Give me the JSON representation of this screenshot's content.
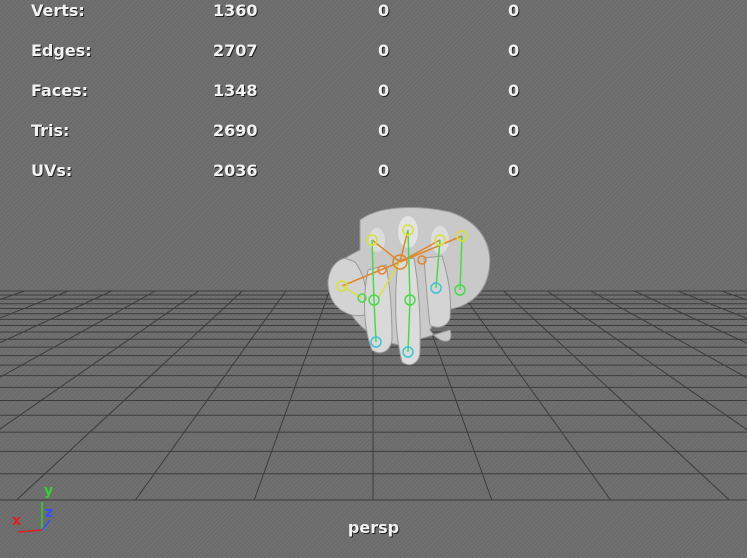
{
  "hud": {
    "rows": [
      {
        "label": "Verts:",
        "v1": "1360",
        "v2": "0",
        "v3": "0"
      },
      {
        "label": "Edges:",
        "v1": "2707",
        "v2": "0",
        "v3": "0"
      },
      {
        "label": "Faces:",
        "v1": "1348",
        "v2": "0",
        "v3": "0"
      },
      {
        "label": "Tris:",
        "v1": "2690",
        "v2": "0",
        "v3": "0"
      },
      {
        "label": "UVs:",
        "v1": "2036",
        "v2": "0",
        "v3": "0"
      }
    ]
  },
  "camera": {
    "name": "persp"
  },
  "axes": {
    "x": "x",
    "y": "y",
    "z": "z"
  },
  "colors": {
    "background": "#6b6b6b",
    "grid": "#3c3c3c",
    "mesh": "#c8c8c8",
    "joint_yellow": "#d6e23a",
    "joint_green": "#4bd94b",
    "joint_cyan": "#3ec4d6",
    "joint_orange": "#e0862a",
    "axis_x": "#e02020",
    "axis_y": "#32d232",
    "axis_z": "#3250ff"
  }
}
